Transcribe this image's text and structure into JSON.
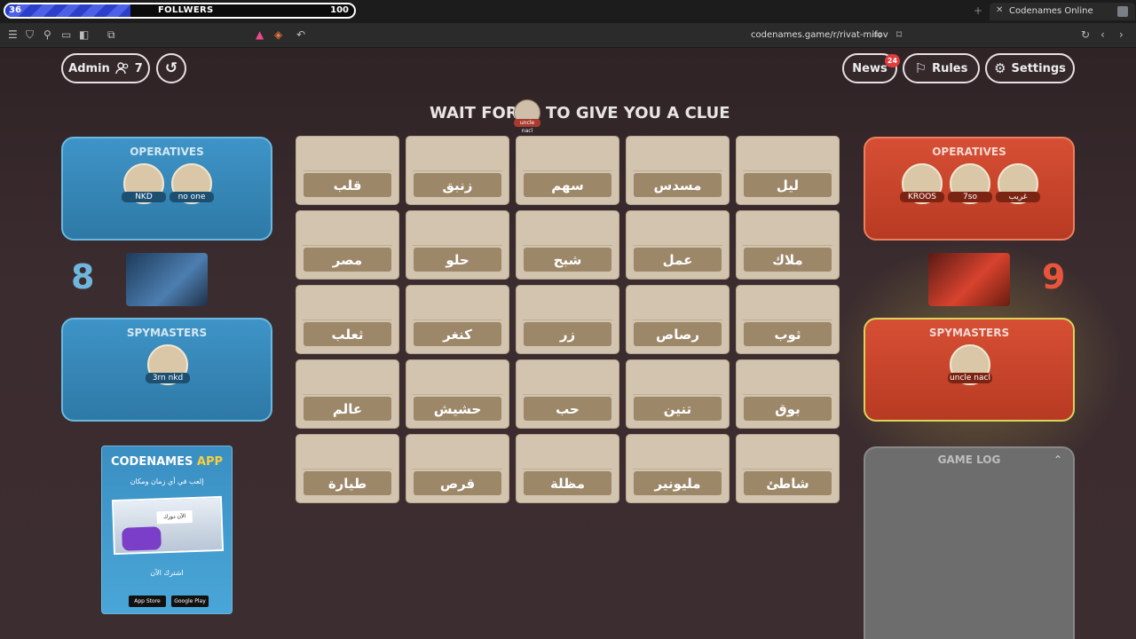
{
  "browser": {
    "progress_value": 36,
    "progress_label": "FOLLWERS",
    "progress_max": 100,
    "tab_title": "Codenames Online",
    "url": "codenames.game/r/rivat-mifov",
    "icons": [
      "menu-icon",
      "shield-icon",
      "pin-icon",
      "window-icon",
      "sidebar-icon",
      "screenshot-icon",
      "triangle-icon",
      "brave-icon",
      "share-icon",
      "translate-icon",
      "bookmark-icon",
      "reload-icon",
      "back-icon",
      "forward-icon"
    ]
  },
  "header": {
    "admin_label": "Admin",
    "player_count": "7",
    "news_label": "News",
    "news_badge": "24",
    "rules_label": "Rules",
    "settings_label": "Settings"
  },
  "clue": {
    "left": "WAIT FOR",
    "right": "TO GIVE YOU A CLUE",
    "avatar_tag": "uncle nacl"
  },
  "blue": {
    "operatives_title": "OPERATIVES",
    "operatives": [
      "NKD",
      "no one"
    ],
    "score": "8",
    "spymasters_title": "SPYMASTERS",
    "spymasters": [
      "3rn nkd"
    ],
    "color": "#3e94c7"
  },
  "red": {
    "operatives_title": "OPERATIVES",
    "operatives": [
      "KROOS",
      "7so",
      "غريب"
    ],
    "score": "9",
    "spymasters_title": "SPYMASTERS",
    "spymasters": [
      "uncle nacl"
    ],
    "color": "#d64f34"
  },
  "board": {
    "rows": [
      [
        "قلب",
        "زنبق",
        "سهم",
        "مسدس",
        "ليل"
      ],
      [
        "مصر",
        "حلو",
        "شبح",
        "عمل",
        "ملاك"
      ],
      [
        "ثعلب",
        "كنغر",
        "زر",
        "رصاص",
        "ثوب"
      ],
      [
        "عالم",
        "حشيش",
        "حب",
        "تنين",
        "بوق"
      ],
      [
        "طيارة",
        "قرص",
        "مظلة",
        "مليونير",
        "شاطئ"
      ]
    ]
  },
  "app_promo": {
    "title_main": "CODENAMES",
    "title_accent": "APP",
    "subtitle": "إلعب في أي زمان ومكان",
    "badge": "الآن دورك",
    "cta": "اشترك الآن",
    "app_store": "App Store",
    "google_play": "Google Play"
  },
  "game_log": {
    "title": "GAME LOG"
  }
}
